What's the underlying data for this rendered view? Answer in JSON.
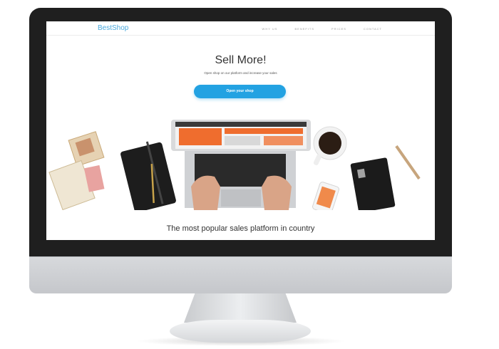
{
  "site": {
    "logo": "BestShop"
  },
  "nav": {
    "items": [
      {
        "label": "WHY US"
      },
      {
        "label": "BENEFITS"
      },
      {
        "label": "PRICES"
      },
      {
        "label": "CONTACT"
      }
    ]
  },
  "hero": {
    "title": "Sell More!",
    "subtitle": "Open shop on our platform and increase your sales",
    "cta_label": "Open your shop"
  },
  "section": {
    "tagline": "The most popular sales platform in country"
  },
  "colors": {
    "brand": "#23a2e2",
    "logo": "#4aa9dd",
    "bezel": "#1f1f1f"
  },
  "icons": [
    "monitor",
    "laptop",
    "notebook",
    "coffee-cup",
    "smartphone",
    "pencil",
    "greeting-cards"
  ]
}
